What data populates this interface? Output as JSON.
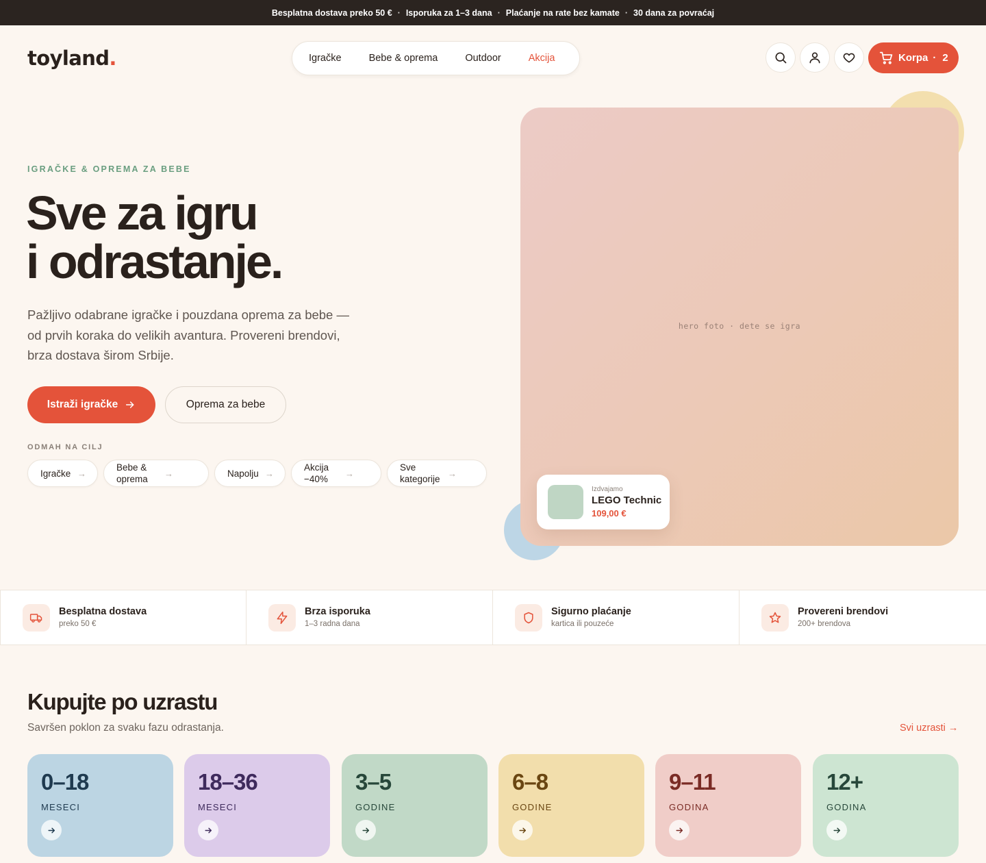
{
  "colors": {
    "accent": "#e4533a",
    "dark": "#2b2420",
    "green_eyebrow": "#6a9e80",
    "background": "#fcf6f0"
  },
  "topbar": {
    "items": [
      "Besplatna dostava preko 50 €",
      "Isporuka za 1–3 dana",
      "Plaćanje na rate bez kamate",
      "30 dana za povraćaj"
    ],
    "separator": "·"
  },
  "logo": {
    "text": "toyland",
    "dot": "."
  },
  "nav": {
    "items": [
      "Igračke",
      "Bebe & oprema",
      "Outdoor",
      "Akcija"
    ]
  },
  "header_icons": [
    "search-icon",
    "user-icon",
    "heart-icon"
  ],
  "cart": {
    "label": "Korpa",
    "sep": "·",
    "count": "2",
    "icon": "cart-icon"
  },
  "hero": {
    "eyebrow": "IGRAČKE & OPREMA ZA BEBE",
    "title_line1": "Sve za igru",
    "title_line2": "i odrastanje.",
    "lead": "Pažljivo odabrane igračke i pouzdana oprema za bebe — od prvih koraka do velikih avantura. Provereni brendovi, brza dostava širom Srbije.",
    "primary_cta": "Istraži igračke",
    "secondary_cta": "Oprema za bebe",
    "quick_title": "ODMAH NA CILJ",
    "chips": [
      "Igračke",
      "Bebe & oprema",
      "Napolju",
      "Akcija −40%",
      "Sve kategorije"
    ],
    "chip_arrow": "→",
    "image_placeholder": "hero foto · dete se igra",
    "featured": {
      "kicker": "Izdvajamo",
      "title": "LEGO Technic",
      "price": "109,00 €"
    }
  },
  "features": [
    {
      "title": "Besplatna dostava",
      "subtitle": "preko 50 €",
      "icon": "truck-icon"
    },
    {
      "title": "Brza isporuka",
      "subtitle": "1–3 radna dana",
      "icon": "bolt-icon"
    },
    {
      "title": "Sigurno plaćanje",
      "subtitle": "kartica ili pouzeće",
      "icon": "shield-icon"
    },
    {
      "title": "Provereni brendovi",
      "subtitle": "200+ brendova",
      "icon": "star-icon"
    }
  ],
  "age_section": {
    "title": "Kupujte po uzrastu",
    "subtitle": "Savršen poklon za svaku fazu odrastanja.",
    "link": "Svi uzrasti →",
    "cards": [
      {
        "range": "0–18",
        "unit": "MESECI",
        "bg": "#bcd5e3",
        "fg": "#1f3a4f"
      },
      {
        "range": "18–36",
        "unit": "MESECI",
        "bg": "#dccbea",
        "fg": "#3e2a5c"
      },
      {
        "range": "3–5",
        "unit": "GODINE",
        "bg": "#c1d9c7",
        "fg": "#27473a"
      },
      {
        "range": "6–8",
        "unit": "GODINE",
        "bg": "#f2deac",
        "fg": "#6a4612"
      },
      {
        "range": "9–11",
        "unit": "GODINA",
        "bg": "#f0cdc8",
        "fg": "#7a2b25"
      },
      {
        "range": "12+",
        "unit": "GODINA",
        "bg": "#cde5d2",
        "fg": "#27473a"
      }
    ]
  }
}
